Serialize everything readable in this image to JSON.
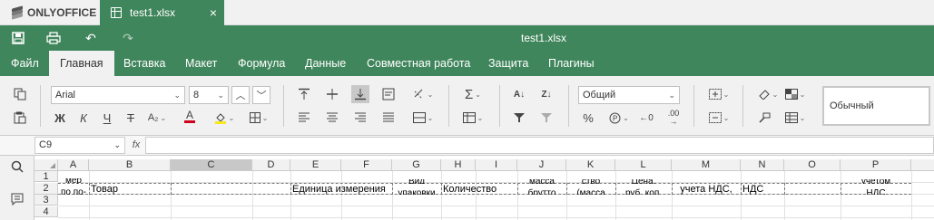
{
  "app": {
    "brand": "ONLYOFFICE"
  },
  "tab": {
    "title": "test1.xlsx",
    "close": "×"
  },
  "header": {
    "doc_title": "test1.xlsx"
  },
  "menu": {
    "tabs": [
      "Файл",
      "Главная",
      "Вставка",
      "Макет",
      "Формула",
      "Данные",
      "Совместная работа",
      "Защита",
      "Плагины"
    ],
    "active": "Главная"
  },
  "toolbar": {
    "font_name": "Arial",
    "font_size": "8",
    "number_format": "Общий",
    "cell_style": "Обычный",
    "bold": "Ж",
    "italic": "К",
    "underline": "Ч",
    "strike": "Т",
    "subscript": "A₂",
    "font_color": "A",
    "percent": "%",
    "sigma": "Σ",
    "colors": {
      "font_color_bar": "#d0021b",
      "fill_color_bar": "#f8e71c"
    }
  },
  "formula_bar": {
    "cell_ref": "C9",
    "fx": "fx",
    "formula": ""
  },
  "grid": {
    "columns": [
      "A",
      "B",
      "C",
      "D",
      "E",
      "F",
      "G",
      "H",
      "I",
      "J",
      "K",
      "L",
      "M",
      "N",
      "O",
      "P"
    ],
    "selected_column": "C",
    "rows": [
      "1",
      "2",
      "3",
      "4"
    ],
    "row2": {
      "A_top": "мер",
      "A_bottom": "по по-",
      "B": "Товар",
      "E": "Единица измерения",
      "G_top": "Вид",
      "G_bottom": "упаковки",
      "H": "Количество",
      "J_top": "масса",
      "J_bottom": "брутто",
      "K_top": "ство",
      "K_bottom": "(масса",
      "L_top": "Цена,",
      "L_bottom": "руб. коп.",
      "M": "учета НДС,",
      "N": "НДС",
      "P_top": "учетом",
      "P_bottom": "НДС"
    }
  }
}
